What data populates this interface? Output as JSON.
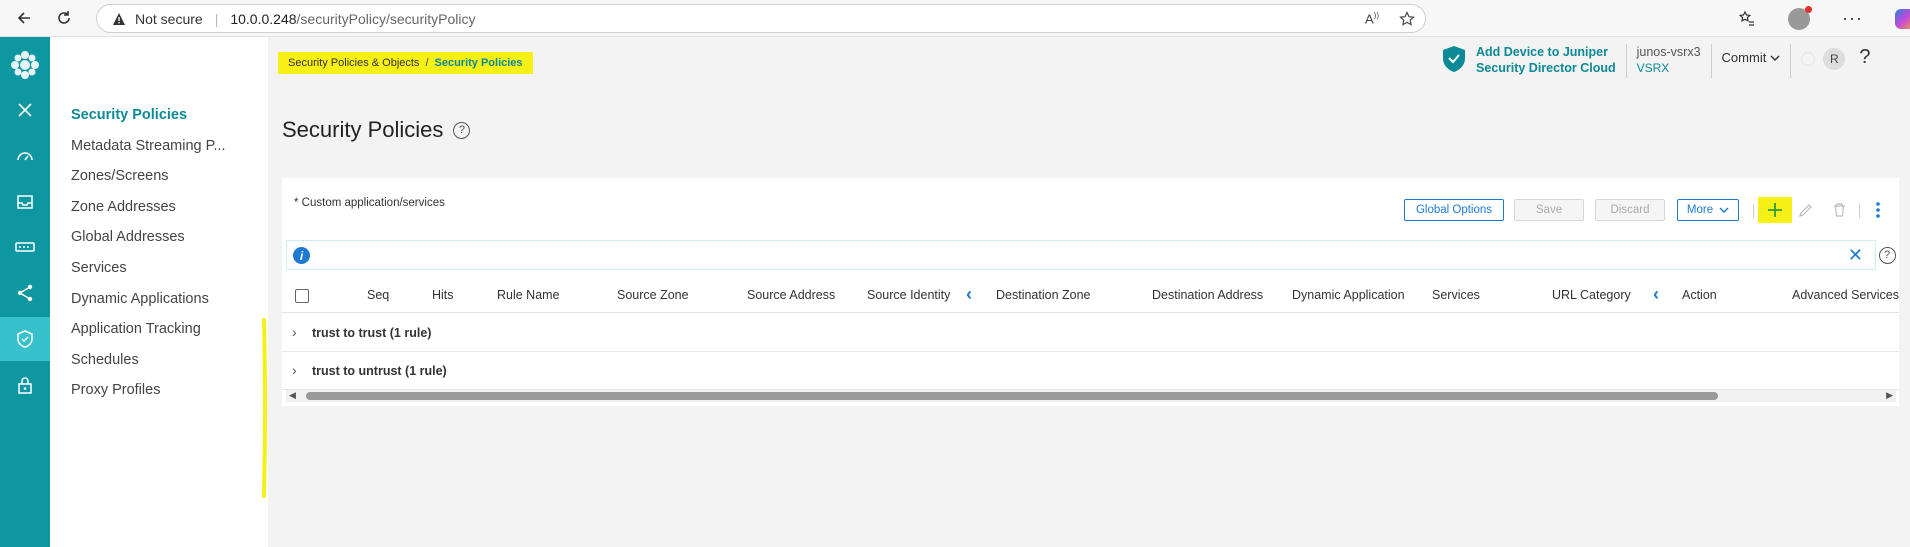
{
  "browser": {
    "not_secure": "Not secure",
    "url_host": "10.0.0.248",
    "url_path": "/securityPolicy/securityPolicy"
  },
  "subnav": {
    "items": [
      {
        "label": "Security Policies",
        "active": true
      },
      {
        "label": "Metadata Streaming P...",
        "active": false
      },
      {
        "label": "Zones/Screens",
        "active": false
      },
      {
        "label": "Zone Addresses",
        "active": false
      },
      {
        "label": "Global Addresses",
        "active": false
      },
      {
        "label": "Services",
        "active": false
      },
      {
        "label": "Dynamic Applications",
        "active": false
      },
      {
        "label": "Application Tracking",
        "active": false
      },
      {
        "label": "Schedules",
        "active": false
      },
      {
        "label": "Proxy Profiles",
        "active": false
      }
    ]
  },
  "breadcrumb": {
    "parent": "Security Policies & Objects",
    "separator": "/",
    "current": "Security Policies"
  },
  "page": {
    "title": "Security Policies"
  },
  "header": {
    "jsd_line1": "Add Device to Juniper",
    "jsd_line2": "Security Director Cloud",
    "device_name": "junos-vsrx3",
    "device_model": "VSRX",
    "commit_label": "Commit",
    "avatar_initial": "R",
    "help": "?"
  },
  "panel": {
    "custom_note": "* Custom application/services",
    "buttons": {
      "global_options": "Global Options",
      "save": "Save",
      "discard": "Discard",
      "more": "More"
    }
  },
  "table": {
    "columns": [
      "Seq",
      "Hits",
      "Rule Name",
      "Source Zone",
      "Source Address",
      "Source Identity",
      "Destination Zone",
      "Destination Address",
      "Dynamic Application",
      "Services",
      "URL Category",
      "Action",
      "Advanced Services"
    ],
    "groups": [
      {
        "label": "trust to trust (1 rule)"
      },
      {
        "label": "trust to untrust (1 rule)"
      }
    ]
  },
  "colors": {
    "rail": "#0e97a1",
    "rail_active": "#36c1cc",
    "accent": "#0c8a96",
    "link_blue": "#1e7ad1",
    "highlight": "#f7f016"
  }
}
